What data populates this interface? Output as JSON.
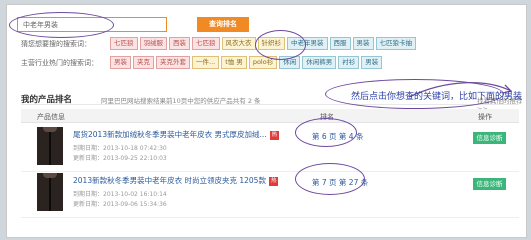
{
  "search": {
    "value": "中老年男装",
    "button_label": "查询排名"
  },
  "suggest_row": {
    "label": "猜您想要搜的搜索词：",
    "tags": [
      {
        "text": "七匹狼",
        "style": "pink"
      },
      {
        "text": "羽绒服",
        "style": "pink"
      },
      {
        "text": "西装",
        "style": "pink"
      },
      {
        "text": "七匹狼",
        "style": "pink"
      },
      {
        "text": "风衣大衣",
        "style": "yellow"
      },
      {
        "text": "针织衫",
        "style": "yellow"
      },
      {
        "text": "中老年男装",
        "style": "blue"
      },
      {
        "text": "西服",
        "style": "blue"
      },
      {
        "text": "男装",
        "style": "blue"
      },
      {
        "text": "七匹狼卡抽",
        "style": "blue"
      }
    ]
  },
  "industry_row": {
    "label": "主营行业热门的搜索词：",
    "tags": [
      {
        "text": "男装",
        "style": "pink"
      },
      {
        "text": "夹克",
        "style": "pink"
      },
      {
        "text": "夹克外套",
        "style": "pink"
      },
      {
        "text": "一件...",
        "style": "yellow"
      },
      {
        "text": "t恤 男",
        "style": "yellow"
      },
      {
        "text": "polo衫",
        "style": "yellow"
      },
      {
        "text": "休闲",
        "style": "blue"
      },
      {
        "text": "休闲裤男",
        "style": "blue"
      },
      {
        "text": "衬衫",
        "style": "blue"
      },
      {
        "text": "男装",
        "style": "blue"
      }
    ]
  },
  "section": {
    "title": "我的产品排名",
    "subtitle": "阿里巴巴网站搜索结果前10页中您的供应产品共有 2 条",
    "more_link": "找看其他的推荐 >>"
  },
  "annotation": "然后点击你想查的关键词，比如下面的男装",
  "table": {
    "headers": {
      "product": "产品信息",
      "rank": "排名",
      "op": "操作"
    },
    "rows": [
      {
        "title": "尾货2013新款加绒秋冬季男装中老年皮衣 男式厚皮加绒...",
        "hot": "热",
        "expire": "到期日期：2013-10-18 07:42:30",
        "update": "更新日期：2013-09-25 22:10:03",
        "rank": "第 6 页 第 4 条",
        "op_label": "信息诊断"
      },
      {
        "title": "2013新款秋冬季男装中老年皮衣 时尚立领皮夹克 1205款",
        "hot": "热",
        "expire": "到期日期：2013-10-02 16:10:14",
        "update": "更新日期：2013-09-06 15:34:36",
        "rank": "第 7 页 第 27 条",
        "op_label": "信息诊断"
      }
    ]
  },
  "colors": {
    "accent": "#f08a24",
    "tag_pink": "#fbe3e3",
    "tag_yellow": "#fbf3d2",
    "tag_blue": "#e0f0f5",
    "button_green": "#3bb57a",
    "annotation": "#2a3fa8",
    "marker": "#6d4a9e"
  }
}
